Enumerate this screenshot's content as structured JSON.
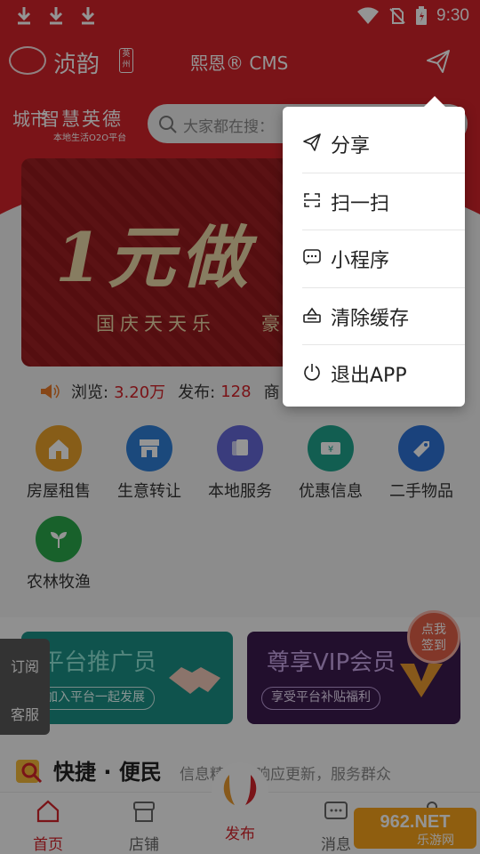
{
  "status_bar": {
    "time": "9:30"
  },
  "header": {
    "logo_text": "浈韵",
    "logo_seal": "英州",
    "title": "熙恩® CMS"
  },
  "brand": {
    "cheng": "城市",
    "main": "智慧英德",
    "sub": "本地生活O2O平台"
  },
  "search": {
    "placeholder": "大家都在搜："
  },
  "banner": {
    "headline": "1元做",
    "subline": "国庆天天乐",
    "subline2": "豪"
  },
  "stats": {
    "views_label": "浏览:",
    "views_value": "3.20万",
    "posts_label": "发布:",
    "posts_value": "128",
    "extra": "商"
  },
  "categories": [
    {
      "label": "房屋租售",
      "icon": "house-icon",
      "color": "#e8a02a"
    },
    {
      "label": "生意转让",
      "icon": "shop-icon",
      "color": "#2f7fd6"
    },
    {
      "label": "本地服务",
      "icon": "service-icon",
      "color": "#6468d8"
    },
    {
      "label": "优惠信息",
      "icon": "coupon-icon",
      "color": "#1fa38c"
    },
    {
      "label": "二手物品",
      "icon": "tag-icon",
      "color": "#2d73d6"
    },
    {
      "label": "农林牧渔",
      "icon": "sprout-icon",
      "color": "#2aa84a"
    }
  ],
  "promos": [
    {
      "title": "平台推广员",
      "button": "加入平台一起发展"
    },
    {
      "title": "尊享VIP会员",
      "button": "享受平台补贴福利"
    }
  ],
  "side_tabs": {
    "subscribe": "订阅",
    "service": "客服"
  },
  "float_badge": {
    "line1": "点我",
    "line2": "签到"
  },
  "quick": {
    "title": "快捷 · 便民",
    "desc": "信息精准，响应更新，服务群众"
  },
  "tabbar": {
    "home": "首页",
    "shop": "店铺",
    "publish": "发布",
    "message": "消息"
  },
  "watermark": {
    "top": "962.NET",
    "bottom": "乐游网"
  },
  "menu": {
    "items": [
      {
        "label": "分享",
        "icon": "send-icon"
      },
      {
        "label": "扫一扫",
        "icon": "scan-icon"
      },
      {
        "label": "小程序",
        "icon": "miniprogram-icon"
      },
      {
        "label": "清除缓存",
        "icon": "clear-cache-icon"
      },
      {
        "label": "退出APP",
        "icon": "power-icon"
      }
    ]
  },
  "colors": {
    "brand_red": "#d2232a",
    "overlay": "rgba(0,0,0,0.42)"
  }
}
